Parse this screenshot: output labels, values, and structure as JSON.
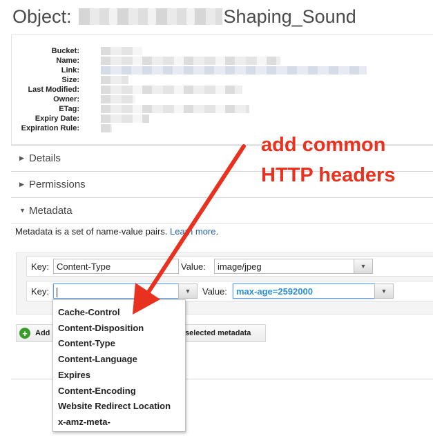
{
  "title": {
    "prefix": "Object:",
    "suffix": "Shaping_Sound"
  },
  "properties": {
    "labels": [
      "Bucket:",
      "Name:",
      "Link:",
      "Size:",
      "Last Modified:",
      "Owner:",
      "ETag:",
      "Expiry Date:",
      "Expiration Rule:"
    ]
  },
  "sections": {
    "details": "Details",
    "permissions": "Permissions",
    "metadata": "Metadata"
  },
  "metadata": {
    "description_pre": "Metadata is a set of name-value pairs. ",
    "description_link": "Learn more",
    "description_post": ".",
    "rows": [
      {
        "key_label": "Key:",
        "key": "Content-Type",
        "value_label": "Value:",
        "value": "image/jpeg"
      },
      {
        "key_label": "Key:",
        "key": "",
        "value_label": "Value:",
        "value": "max-age=2592000"
      }
    ],
    "add_button": "Add",
    "delete_button": "selected metadata"
  },
  "dropdown": {
    "options": [
      "Cache-Control",
      "Content-Disposition",
      "Content-Type",
      "Content-Language",
      "Expires",
      "Content-Encoding",
      "Website Redirect Location",
      "x-amz-meta-"
    ]
  },
  "annotation": {
    "line1": "add common",
    "line2": "HTTP headers",
    "color": "#e8321f"
  }
}
